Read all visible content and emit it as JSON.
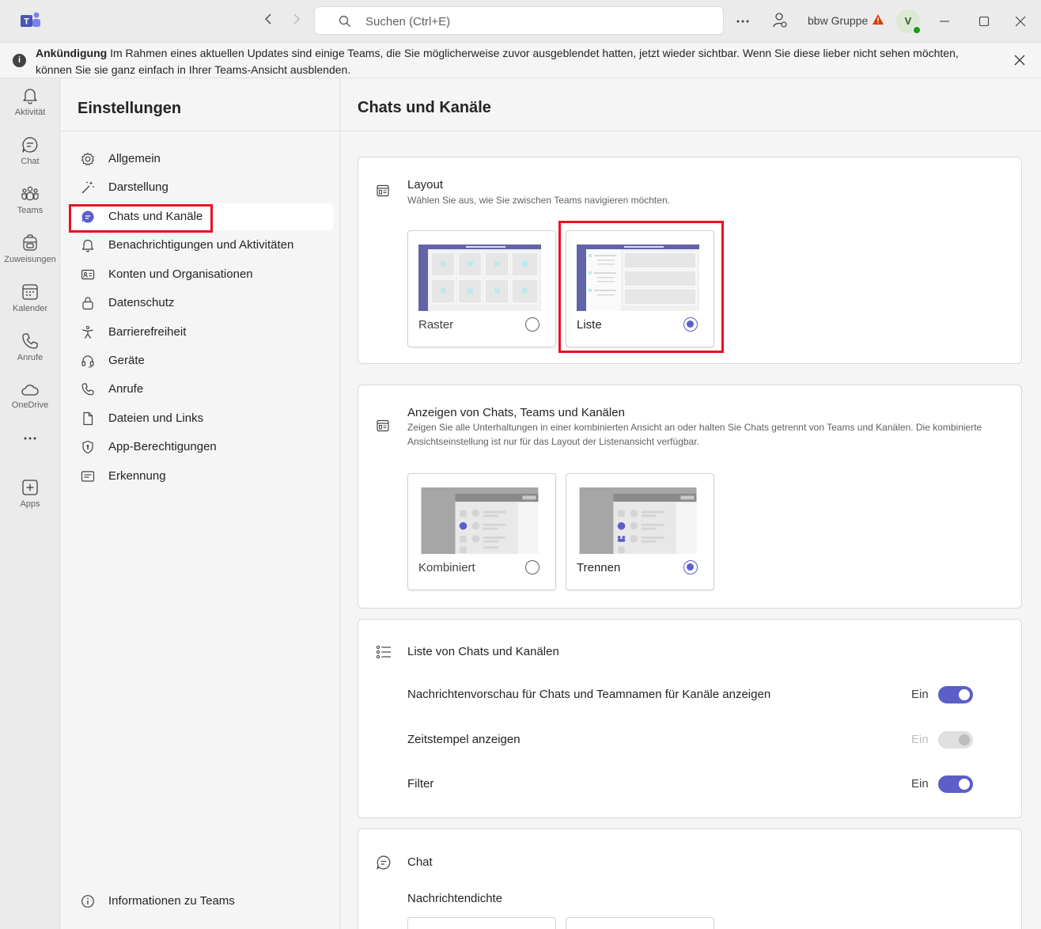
{
  "titlebar": {
    "search_placeholder": "Suchen (Ctrl+E)",
    "org_name": "bbw Gruppe",
    "avatar_initial": "V",
    "brand_color": "#5b5fc7"
  },
  "announcement": {
    "label": "Ankündigung",
    "text": "Im Rahmen eines aktuellen Updates sind einige Teams, die Sie möglicherweise zuvor ausgeblendet hatten, jetzt wieder sichtbar. Wenn Sie diese lieber nicht sehen möchten, können Sie sie ganz einfach in Ihrer Teams-Ansicht ausblenden."
  },
  "rail": {
    "items": [
      {
        "label": "Aktivität",
        "icon": "bell-icon"
      },
      {
        "label": "Chat",
        "icon": "chat-icon"
      },
      {
        "label": "Teams",
        "icon": "teams-icon"
      },
      {
        "label": "Zuweisungen",
        "icon": "backpack-icon"
      },
      {
        "label": "Kalender",
        "icon": "calendar-icon"
      },
      {
        "label": "Anrufe",
        "icon": "phone-icon"
      },
      {
        "label": "OneDrive",
        "icon": "cloud-icon"
      },
      {
        "label": "Apps",
        "icon": "add-app-icon"
      }
    ]
  },
  "settings": {
    "title": "Einstellungen",
    "items": [
      {
        "label": "Allgemein",
        "icon": "gear-icon"
      },
      {
        "label": "Darstellung",
        "icon": "magic-wand-icon"
      },
      {
        "label": "Chats und Kanäle",
        "icon": "chat-bubble-icon",
        "active": true
      },
      {
        "label": "Benachrichtigungen und Aktivitäten",
        "icon": "bell-icon"
      },
      {
        "label": "Konten und Organisationen",
        "icon": "contact-card-icon"
      },
      {
        "label": "Datenschutz",
        "icon": "lock-icon"
      },
      {
        "label": "Barrierefreiheit",
        "icon": "accessibility-icon"
      },
      {
        "label": "Geräte",
        "icon": "headset-icon"
      },
      {
        "label": "Anrufe",
        "icon": "phone-icon"
      },
      {
        "label": "Dateien und Links",
        "icon": "document-icon"
      },
      {
        "label": "App-Berechtigungen",
        "icon": "shield-icon"
      },
      {
        "label": "Erkennung",
        "icon": "text-box-icon"
      }
    ],
    "footer": {
      "label": "Informationen zu Teams",
      "icon": "info-icon"
    }
  },
  "main": {
    "title": "Chats und Kanäle",
    "layout": {
      "title": "Layout",
      "subtitle": "Wählen Sie aus, wie Sie zwischen Teams navigieren möchten.",
      "options": [
        {
          "label": "Raster",
          "selected": false
        },
        {
          "label": "Liste",
          "selected": true
        }
      ]
    },
    "display": {
      "title": "Anzeigen von Chats, Teams und Kanälen",
      "subtitle": "Zeigen Sie alle Unterhaltungen in einer kombinierten Ansicht an oder halten Sie Chats getrennt von Teams und Kanälen. Die kombinierte Ansichtseinstellung ist nur für das Layout der Listenansicht verfügbar.",
      "options": [
        {
          "label": "Kombiniert",
          "selected": false
        },
        {
          "label": "Trennen",
          "selected": true
        }
      ]
    },
    "list": {
      "title": "Liste von Chats und Kanälen",
      "rows": [
        {
          "label": "Nachrichtenvorschau für Chats und Teamnamen für Kanäle anzeigen",
          "state": "Ein",
          "on": true,
          "disabled": false
        },
        {
          "label": "Zeitstempel anzeigen",
          "state": "Ein",
          "on": true,
          "disabled": true
        },
        {
          "label": "Filter",
          "state": "Ein",
          "on": true,
          "disabled": false
        }
      ]
    },
    "chat": {
      "title": "Chat",
      "density_label": "Nachrichtendichte"
    }
  }
}
